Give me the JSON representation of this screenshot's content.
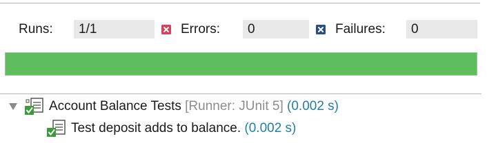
{
  "summary": {
    "runs_label": "Runs:",
    "runs_value": "1/1",
    "errors_label": "Errors:",
    "errors_value": "0",
    "failures_label": "Failures:",
    "failures_value": "0"
  },
  "progress": {
    "fraction": 1.0,
    "status": "passed",
    "fill_color": "#5ebe5e"
  },
  "tree": {
    "suite": {
      "name": "Account Balance Tests",
      "runner": "[Runner: JUnit 5]",
      "duration": "(0.002 s)",
      "icon": "test-suite-passed-icon",
      "expanded": true,
      "tests": [
        {
          "name": "Test deposit adds to balance.",
          "duration": "(0.002 s)",
          "icon": "test-passed-icon"
        }
      ]
    }
  },
  "colors": {
    "error_icon": "#d9405a",
    "failure_icon": "#2b4d83",
    "pass_check": "#3d9b3d",
    "duration_text": "#1f7fa4",
    "runner_text": "#8c8c8c"
  }
}
